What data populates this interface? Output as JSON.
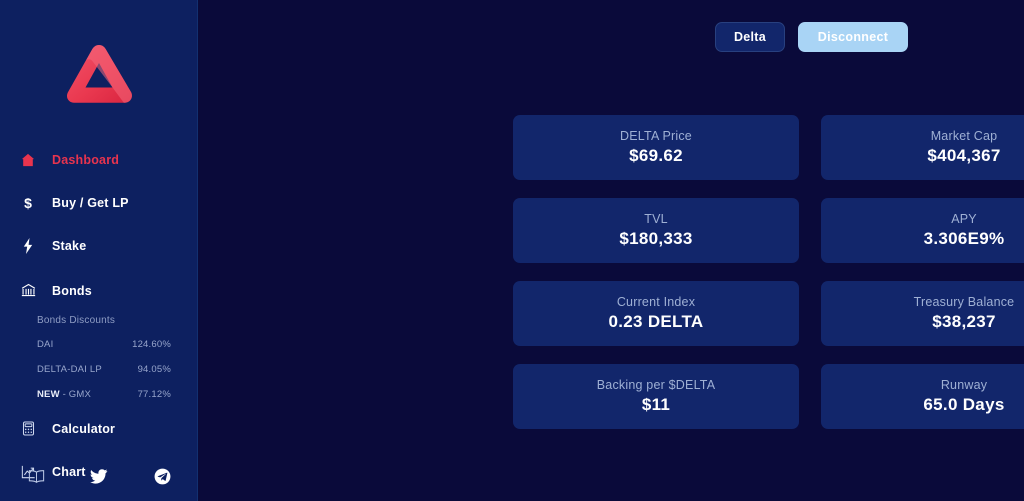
{
  "theme": {
    "bg": "#0a0a3a",
    "sidebar_bg": "#0d2060",
    "card_bg": "#12266b",
    "accent_red": "#e8344e",
    "accent_blue": "#a9d4f5",
    "muted_text": "#9fb0d4"
  },
  "sidebar": {
    "logo_icon": "delta-triangle-logo",
    "nav": [
      {
        "label": "Dashboard",
        "icon": "home-icon",
        "active": true
      },
      {
        "label": "Buy / Get LP",
        "icon": "dollar-icon",
        "active": false
      },
      {
        "label": "Stake",
        "icon": "lightning-icon",
        "active": false
      },
      {
        "label": "Bonds",
        "icon": "bank-icon",
        "active": false
      }
    ],
    "bonds": {
      "heading": "Bonds Discounts",
      "rows": [
        {
          "name": "DAI",
          "highlight": "",
          "discount": "124.60%"
        },
        {
          "name": "DELTA-DAI LP",
          "highlight": "",
          "discount": "94.05%"
        },
        {
          "name": "- GMX",
          "highlight": "NEW",
          "discount": "77.12%"
        }
      ]
    },
    "nav_bottom": [
      {
        "label": "Calculator",
        "icon": "calculator-icon"
      },
      {
        "label": "Chart",
        "icon": "chart-line-icon"
      }
    ],
    "socials": [
      {
        "name": "docs-book-icon"
      },
      {
        "name": "twitter-icon"
      },
      {
        "name": "telegram-icon"
      }
    ]
  },
  "topbar": {
    "wallet_label": "Delta",
    "disconnect_label": "Disconnect"
  },
  "metrics": [
    {
      "label": "DELTA Price",
      "value": "$69.62"
    },
    {
      "label": "Market Cap",
      "value": "$404,367"
    },
    {
      "label": "TVL",
      "value": "$180,333"
    },
    {
      "label": "APY",
      "value": "3.306E9%"
    },
    {
      "label": "Current Index",
      "value": "0.23 DELTA"
    },
    {
      "label": "Treasury Balance",
      "value": "$38,237"
    },
    {
      "label": "Backing per $DELTA",
      "value": "$11"
    },
    {
      "label": "Runway",
      "value": "65.0 Days"
    }
  ]
}
